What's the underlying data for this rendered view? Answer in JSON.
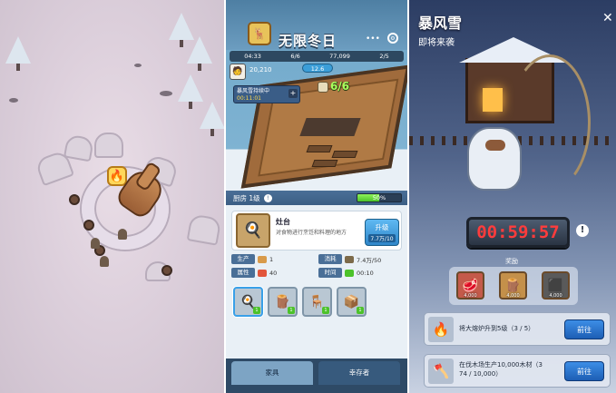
{
  "panel2": {
    "title": "无限冬日",
    "resources": [
      "04:33",
      "6/6",
      "77,099",
      "2/5"
    ],
    "stat_value": "20,210",
    "stat_pill": "12.6",
    "alert": {
      "title": "暴风雪持续中",
      "timer": "00:11:01"
    },
    "crew": "6/6",
    "room_name": "厨房 1级",
    "room_progress": 0.5,
    "room_progress_label": "50%",
    "facility": {
      "name": "灶台",
      "desc": "对食物进行烹饪和料理的地方",
      "upgrade_label": "升级",
      "upgrade_cost": "7.7万/10"
    },
    "attributes": [
      {
        "key": "生产",
        "value": "1"
      },
      {
        "key": "消耗",
        "value": "7.4万/50"
      },
      {
        "key": "属性",
        "value": "40"
      },
      {
        "key": "时间",
        "value": "00:10"
      }
    ],
    "slot_levels": [
      "1",
      "1",
      "1",
      "1"
    ],
    "tabs": {
      "furniture": "家具",
      "survivors": "幸存者"
    }
  },
  "panel3": {
    "title": "暴风雪",
    "subtitle": "即将来袭",
    "timer": "00:59:57",
    "reward_label": "奖励",
    "rewards": [
      {
        "icon": "meat-icon",
        "qty": "4,000"
      },
      {
        "icon": "wood-icon",
        "qty": "4,000"
      },
      {
        "icon": "coal-icon",
        "qty": "4,000"
      }
    ],
    "tasks": [
      {
        "desc": "将大熔炉升到5级（3 / 5）",
        "button": "前往"
      },
      {
        "desc_line1": "在伐木场生产10,000木材（3",
        "desc_line2": "74 / 10,000）",
        "button": "前往"
      }
    ]
  },
  "colors": {
    "timer": "#ff3c3c",
    "progress": "#4cc22a",
    "button": "#2f86c9",
    "crew": "#a8ff5e"
  }
}
